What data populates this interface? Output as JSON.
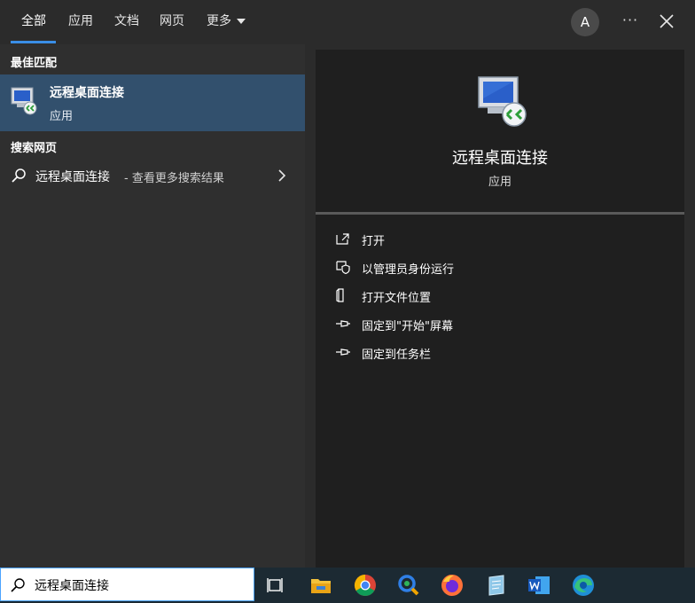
{
  "tabs": [
    {
      "label": "全部",
      "active": true
    },
    {
      "label": "应用"
    },
    {
      "label": "文档"
    },
    {
      "label": "网页"
    },
    {
      "label": "更多"
    }
  ],
  "user_initial": "A",
  "more_glyph": "···",
  "left": {
    "best_match_title": "最佳匹配",
    "best_match": {
      "name": "远程桌面连接",
      "type": "应用",
      "icon": "remote-desktop-icon"
    },
    "web_title": "搜索网页",
    "web_result": {
      "main": "远程桌面连接",
      "sub": " - 查看更多搜索结果"
    }
  },
  "right": {
    "app_name": "远程桌面连接",
    "app_type": "应用",
    "actions": [
      {
        "label": "打开",
        "icon": "open-icon"
      },
      {
        "label": "以管理员身份运行",
        "icon": "admin-shield-icon"
      },
      {
        "label": "打开文件位置",
        "icon": "file-location-icon"
      },
      {
        "label": "固定到\"开始\"屏幕",
        "icon": "pin-icon"
      },
      {
        "label": "固定到任务栏",
        "icon": "pin-icon"
      }
    ]
  },
  "search": {
    "value": "远程桌面连接"
  },
  "taskbar_icons": [
    "task-view-icon",
    "file-explorer-icon",
    "chrome-icon",
    "search-app-icon",
    "firefox-icon",
    "notepad-icon",
    "word-icon",
    "edge-icon"
  ],
  "colors": {
    "accent": "#3a8ee6",
    "selection": "#32506d",
    "taskbar": "#1c2a33"
  }
}
